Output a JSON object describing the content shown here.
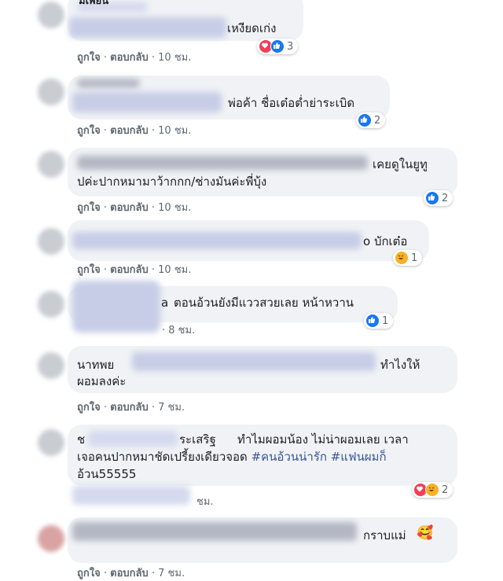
{
  "comments": [
    {
      "text": "เหงียดเก่ง",
      "actions": {
        "like": "ถูกใจ",
        "reply": "ตอบกลับ",
        "time": "10 ชม."
      },
      "reactions": {
        "types": [
          "love",
          "like"
        ],
        "count": "3"
      }
    },
    {
      "text": "พ่อค้า ชื่อเต๋อต่ำย่าระเบิด",
      "actions": {
        "like": "ถูกใจ",
        "reply": "ตอบกลับ",
        "time": "10 ชม."
      },
      "reactions": {
        "types": [
          "like"
        ],
        "count": "2"
      }
    },
    {
      "text_line1": "เคยดูในยูทู",
      "text_line2": "ปค่ะปากหมามาว้ากกก/ช่างมันค่ะพี่บุ้ง",
      "actions": {
        "like": "ถูกใจ",
        "reply": "ตอบกลับ",
        "time": "10 ชม."
      },
      "reactions": {
        "types": [
          "like"
        ],
        "count": "2"
      }
    },
    {
      "text": "o บักเต๋อ",
      "actions": {
        "like": "ถูกใจ",
        "reply": "ตอบกลับ",
        "time": "10 ชม."
      },
      "reactions": {
        "types": [
          "haha"
        ],
        "count": "1"
      }
    },
    {
      "name_fragment": "a",
      "text": "ตอนอ้วนยังมีแววสวยเลย หน้าหวาน",
      "actions": {
        "like": "",
        "reply": "",
        "time": "8 ชม."
      },
      "reactions": {
        "types": [
          "like"
        ],
        "count": "1"
      }
    },
    {
      "name_fragment": "นาทพย",
      "text_line1": "ทำไงให้",
      "text_line2": "ผอมลงค่ะ",
      "actions": {
        "like": "ถูกใจ",
        "reply": "ตอบกลับ",
        "time": "7 ชม."
      },
      "reactions": null
    },
    {
      "name_start": "ช",
      "name_end": "ระเสริฐ",
      "text_line1": "ทำไมผอมน้อง ไม่น่าผอมเลย เวลา",
      "text_line2_plain": "เจอคนปากหมาชัดเปรี้ยงเดียวจอด",
      "tag1": "#คนอ้วนน่ารัก",
      "tag2": "#แฟนผมก็",
      "tag2_cont": "อ้วน55555",
      "actions": {
        "like": "",
        "reply": "",
        "time": "ชม."
      },
      "reactions": {
        "types": [
          "love",
          "haha"
        ],
        "count": "2"
      }
    },
    {
      "text": "กราบแม่",
      "emoji": "🥰",
      "actions": {
        "like": "ถูกใจ",
        "reply": "ตอบกลับ",
        "time": "7 ชม."
      },
      "reactions": null
    }
  ],
  "separator": "·",
  "partial_top_text": "ม้เพียน",
  "colors": {
    "bubble": "#f0f2f5",
    "like": "#1877f2",
    "love": "#f33e58",
    "haha": "#f7b125",
    "hashtag": "#385898"
  }
}
